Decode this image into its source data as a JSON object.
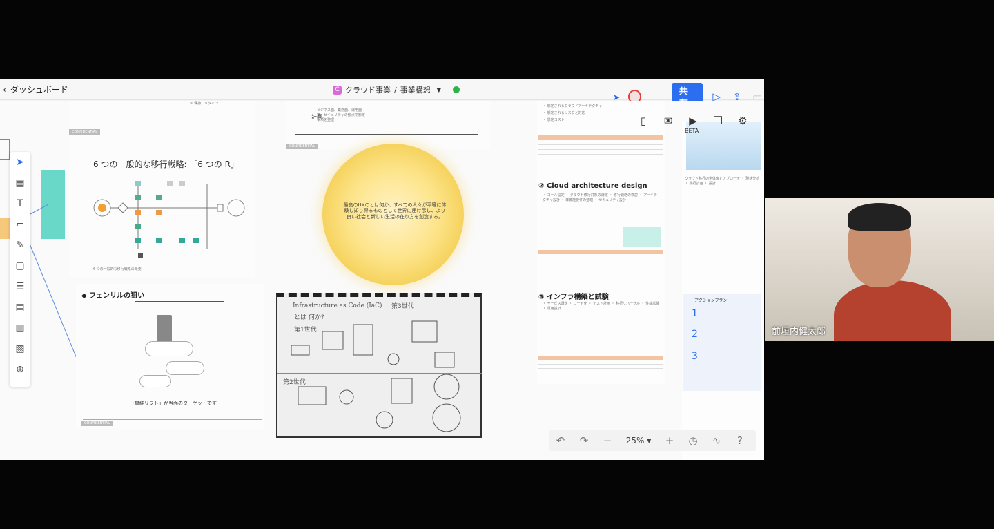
{
  "topbar": {
    "back_label": "ダッシュボード",
    "project_badge": "C",
    "breadcrumb_project": "クラウド事業",
    "breadcrumb_sep": "/",
    "breadcrumb_doc": "事業構想",
    "share_label": "共有"
  },
  "float_tools": {
    "beta_label": "BETA"
  },
  "zoom": {
    "value": "25%",
    "minus": "−",
    "plus": "+"
  },
  "canvas": {
    "migration_title": "6 つの一般的な移行戦略: 「6 つの R」",
    "sphere_text": "最良のUXのとは何か、すべての人々が平等に体験し知り得るものとして世界に届け示し、より良い社会と新しい生活の在り方を創造する。",
    "fenrir_title": "フェンリルの狙い",
    "target_caption": "「単純リフト」が当面のターゲットです",
    "cloud_arch_title": "② Cloud architecture design",
    "infra_title": "③ インフラ構築と試験",
    "plan_label": "計画",
    "confidential": "CONFIDENTIAL",
    "action_plan_title": "アクションプラン",
    "sketch_title": "Infrastructure as Code (IaC)",
    "sketch_sub": "とは 何か?",
    "sketch_gen1": "第1世代",
    "sketch_gen2": "第2世代",
    "sketch_gen3": "第3世代"
  },
  "camera": {
    "participant_name": "前垣内健太郎"
  }
}
